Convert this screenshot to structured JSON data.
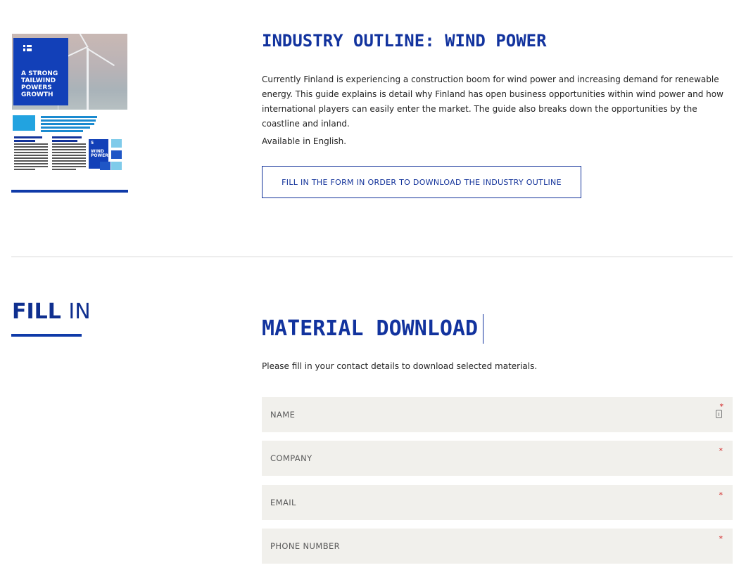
{
  "outline": {
    "cover": {
      "title_line1": "A STRONG",
      "title_line2": "TAILWIND",
      "title_line3": "POWERS",
      "title_line4": "GROWTH",
      "box_line1": "5",
      "box_line2": "WIND",
      "box_line3": "POWER"
    },
    "title": "INDUSTRY OUTLINE: WIND POWER",
    "description": "Currently Finland is experiencing a construction boom for wind power and increasing demand for renewable energy. This guide explains is detail why Finland has open business opportunities within wind power and how international players can easily enter the market. The guide also breaks down the opportunities by the coastline and inland.",
    "availability": "Available in English.",
    "button_label": "FILL IN THE FORM IN ORDER TO DOWNLOAD THE INDUSTRY OUTLINE"
  },
  "fill_in": {
    "bold": "FILL",
    "light": "IN"
  },
  "download": {
    "title": "MATERIAL DOWNLOAD",
    "description": "Please fill in your contact details to download selected materials.",
    "required_marker": "*",
    "fields": [
      {
        "label": "NAME"
      },
      {
        "label": "COMPANY"
      },
      {
        "label": "EMAIL"
      },
      {
        "label": "PHONE NUMBER"
      }
    ]
  },
  "colors": {
    "brand_blue": "#12339e",
    "field_bg": "#f1f0ec",
    "required_red": "#d11f1f"
  }
}
